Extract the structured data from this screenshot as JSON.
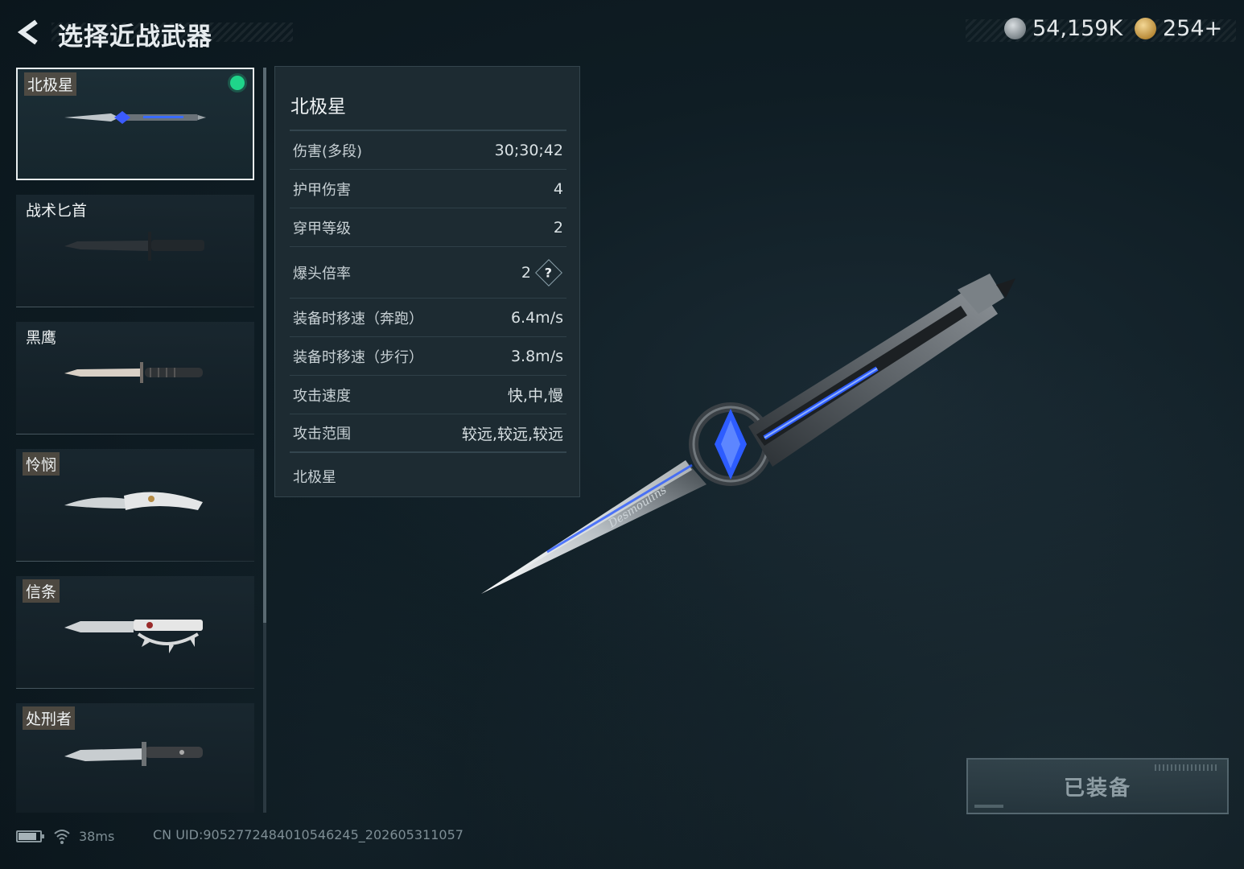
{
  "header": {
    "title": "选择近战武器",
    "back_icon": "back-arrow-icon",
    "currency_silver": "54,159K",
    "currency_gold": "254+"
  },
  "weapons": [
    {
      "name": "北极星",
      "selected": true,
      "equipped": true
    },
    {
      "name": "战术匕首",
      "selected": false
    },
    {
      "name": "黑鹰",
      "selected": false
    },
    {
      "name": "怜悯",
      "selected": false
    },
    {
      "name": "信条",
      "selected": false
    },
    {
      "name": "处刑者",
      "selected": false
    }
  ],
  "stats": {
    "title": "北极星",
    "rows": [
      {
        "label": "伤害(多段)",
        "value": "30;30;42"
      },
      {
        "label": "护甲伤害",
        "value": "4"
      },
      {
        "label": "穿甲等级",
        "value": "2"
      },
      {
        "label": "爆头倍率",
        "value": "2",
        "help": "?"
      },
      {
        "label": "装备时移速（奔跑）",
        "value": "6.4m/s"
      },
      {
        "label": "装备时移速（步行）",
        "value": "3.8m/s"
      },
      {
        "label": "攻击速度",
        "value": "快,中,慢"
      },
      {
        "label": "攻击范围",
        "value": "较远,较远,较远"
      }
    ],
    "description": "北极星"
  },
  "weapon_engraving": "Desmoulins",
  "equip_button": {
    "label": "已装备"
  },
  "footer": {
    "ping": "38ms",
    "uid": "CN UID:9052772484010546245_202605311057"
  },
  "colors": {
    "accent_equipped": "#1fd58a",
    "weapon_glow": "#2d5cff"
  }
}
